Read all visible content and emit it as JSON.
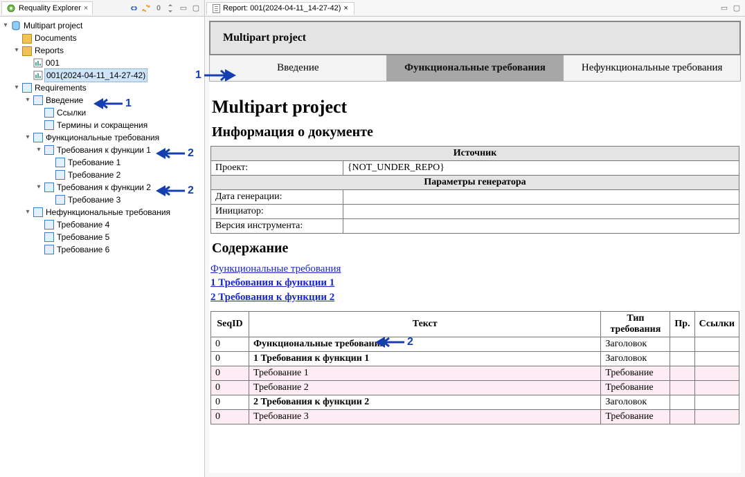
{
  "explorer": {
    "tab_title": "Requality Explorer",
    "toolbar_zero": "0",
    "tree": {
      "root": "Multipart project",
      "documents": "Documents",
      "reports": "Reports",
      "report_001": "001",
      "report_selected": "001(2024-04-11_14-27-42)",
      "requirements": "Requirements",
      "intro": "Введение",
      "links": "Ссылки",
      "terms": "Термины и сокращения",
      "func": "Функциональные требования",
      "func1": "Требования к функции 1",
      "req1": "Требование 1",
      "req2": "Требование 2",
      "func2": "Требования к функции 2",
      "req3": "Требование 3",
      "nonfunc": "Нефункциональные требования",
      "req4": "Требование 4",
      "req5": "Требование 5",
      "req6": "Требование 6"
    }
  },
  "editor": {
    "tab_title": "Report: 001(2024-04-11_14-27-42)"
  },
  "report": {
    "banner": "Multipart project",
    "nav": {
      "intro": "Введение",
      "func": "Функциональные требования",
      "nonfunc": "Нефункциональные требования"
    },
    "h1": "Multipart project",
    "doc_info_title": "Информация о документе",
    "info": {
      "source_header": "Источник",
      "project_label": "Проект:",
      "project_value": "{NOT_UNDER_REPO}",
      "params_header": "Параметры генератора",
      "date_label": "Дата генерации:",
      "date_value": "",
      "initiator_label": "Инициатор:",
      "initiator_value": "",
      "tool_label": "Версия инструмента:",
      "tool_value": ""
    },
    "toc_title": "Содержание",
    "toc": {
      "func": "Функциональные требования",
      "item1": "1 Требования к функции 1",
      "item2": "2 Требования к функции 2"
    },
    "table": {
      "headers": {
        "seq": "SeqID",
        "text": "Текст",
        "type": "Тип требования",
        "pr": "Пр.",
        "links": "Ссылки"
      },
      "rows": [
        {
          "seq": "0",
          "text": "Функциональные требования",
          "type": "Заголовок",
          "bold": true,
          "pink": false
        },
        {
          "seq": "0",
          "text": "1 Требования к функции 1",
          "type": "Заголовок",
          "bold": true,
          "pink": false
        },
        {
          "seq": "0",
          "text": "Требование 1",
          "type": "Требование",
          "bold": false,
          "pink": true
        },
        {
          "seq": "0",
          "text": "Требование 2",
          "type": "Требование",
          "bold": false,
          "pink": true
        },
        {
          "seq": "0",
          "text": "2 Требования к функции 2",
          "type": "Заголовок",
          "bold": true,
          "pink": false
        },
        {
          "seq": "0",
          "text": "Требование 3",
          "type": "Требование",
          "bold": false,
          "pink": true
        }
      ]
    }
  },
  "annotations": {
    "one": "1",
    "two": "2"
  }
}
